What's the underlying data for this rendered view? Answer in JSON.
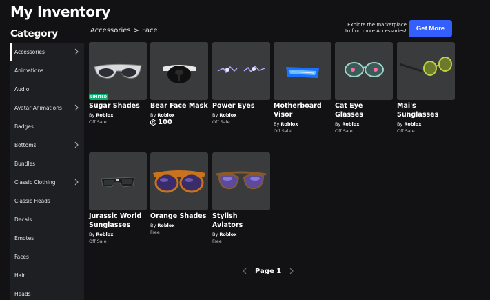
{
  "header": {
    "title": "My Inventory"
  },
  "sidebar": {
    "heading": "Category",
    "items": [
      {
        "label": "Accessories",
        "chevron": true,
        "active": true
      },
      {
        "label": "Animations"
      },
      {
        "label": "Audio"
      },
      {
        "label": "Avatar Animations",
        "chevron": true
      },
      {
        "label": "Badges"
      },
      {
        "label": "Bottoms",
        "chevron": true
      },
      {
        "label": "Bundles"
      },
      {
        "label": "Classic Clothing",
        "chevron": true
      },
      {
        "label": "Classic Heads"
      },
      {
        "label": "Decals"
      },
      {
        "label": "Emotes"
      },
      {
        "label": "Faces"
      },
      {
        "label": "Hair"
      },
      {
        "label": "Heads"
      }
    ]
  },
  "breadcrumb": {
    "parent": "Accessories",
    "separator": ">",
    "current": "Face"
  },
  "promo": {
    "line1": "Explore the marketplace",
    "line2": "to find more Accessories!",
    "button_label": "Get More"
  },
  "items": [
    {
      "name": "Sugar Shades",
      "creator_prefix": "By",
      "creator": "Roblox",
      "price": "Off Sale",
      "badge": "LIMITED",
      "icon": "white-sunglasses-icon"
    },
    {
      "name": "Bear Face Mask",
      "creator_prefix": "By",
      "creator": "Roblox",
      "price": "100",
      "price_is_robux": true,
      "icon": "bear-mask-icon"
    },
    {
      "name": "Power Eyes",
      "creator_prefix": "By",
      "creator": "Roblox",
      "price": "Off Sale",
      "icon": "lightning-eyes-icon"
    },
    {
      "name": "Motherboard Visor",
      "creator_prefix": "By",
      "creator": "Roblox",
      "price": "Off Sale",
      "icon": "blue-visor-icon"
    },
    {
      "name": "Cat Eye Glasses",
      "creator_prefix": "By",
      "creator": "Roblox",
      "price": "Off Sale",
      "icon": "cat-eye-glasses-icon"
    },
    {
      "name": "Mai's Sunglasses",
      "creator_prefix": "By",
      "creator": "Roblox",
      "price": "Off Sale",
      "icon": "green-sunglasses-icon"
    },
    {
      "name": "Jurassic World Sunglasses",
      "creator_prefix": "By",
      "creator": "Roblox",
      "price": "Off Sale",
      "icon": "dark-sunglasses-icon"
    },
    {
      "name": "Orange Shades",
      "creator_prefix": "By",
      "creator": "Roblox",
      "price": "Free",
      "icon": "orange-shades-icon"
    },
    {
      "name": "Stylish Aviators",
      "creator_prefix": "By",
      "creator": "Roblox",
      "price": "Free",
      "icon": "aviator-glasses-icon"
    }
  ],
  "pagination": {
    "label": "Page 1"
  },
  "colors": {
    "background": "#121215",
    "sidebar": "#1e1f23",
    "card": "#393b3d",
    "accent": "#335fff",
    "limited_badge": "#00b06f"
  }
}
